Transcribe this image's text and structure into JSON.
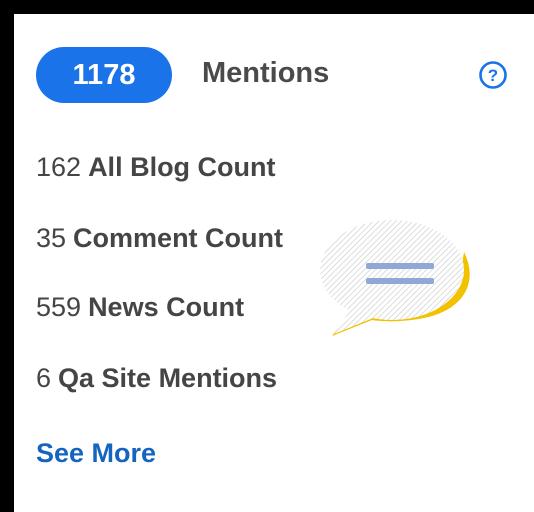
{
  "header": {
    "count": "1178",
    "label": "Mentions"
  },
  "stats": [
    {
      "count": "162",
      "label": "All Blog Count"
    },
    {
      "count": "35",
      "label": "Comment Count"
    },
    {
      "count": "559",
      "label": "News Count"
    },
    {
      "count": "6",
      "label": "Qa Site Mentions"
    }
  ],
  "see_more_label": "See More",
  "icons": {
    "help": "question-circle-icon",
    "illustration": "speech-bubble-icon"
  },
  "colors": {
    "accent": "#1a73e8",
    "link": "#1565c0",
    "text": "#454545",
    "bubble_shadow": "#f2c200"
  }
}
